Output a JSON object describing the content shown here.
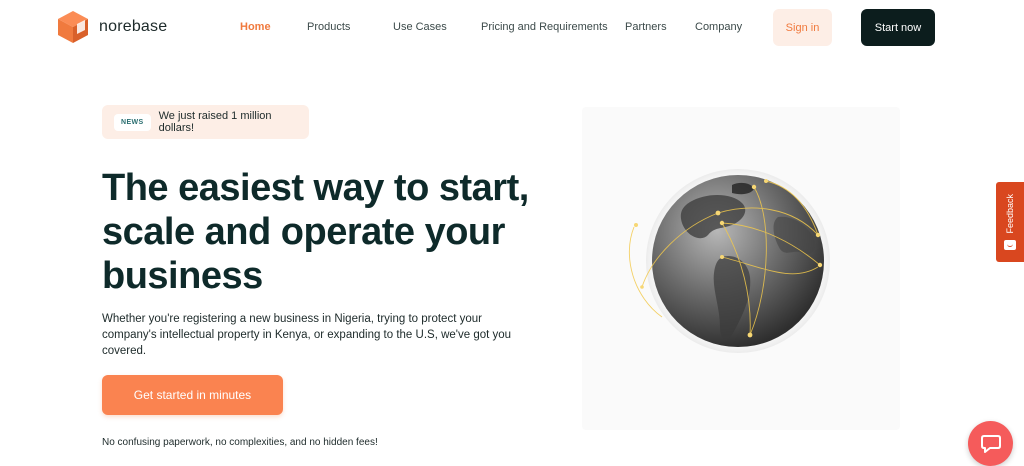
{
  "brand": {
    "name": "norebase",
    "accent": "#f07a3e",
    "dark": "#0c1d1d"
  },
  "nav": {
    "items": [
      {
        "label": "Home",
        "active": true
      },
      {
        "label": "Products",
        "active": false
      },
      {
        "label": "Use Cases",
        "active": false
      },
      {
        "label": "Pricing and Requirements",
        "active": false
      },
      {
        "label": "Partners",
        "active": false
      },
      {
        "label": "Company",
        "active": false
      }
    ],
    "signin_label": "Sign in",
    "start_label": "Start now"
  },
  "news": {
    "badge": "NEWS",
    "text": "We just raised 1 million dollars!"
  },
  "hero": {
    "title": "The easiest way to start, scale and operate your business",
    "subtitle": "Whether you're registering a new business in Nigeria, trying to protect your company's intellectual property in Kenya, or expanding to the U.S, we've got you covered.",
    "cta_label": "Get started in minutes",
    "footnote": "No confusing paperwork, no complexities, and no hidden fees!"
  },
  "feedback": {
    "label": "Feedback",
    "icon": "smile-icon"
  },
  "chat": {
    "icon": "chat-bubble-icon",
    "color": "#f55b5b"
  },
  "globe": {
    "icon": "globe-icon",
    "line_color": "#f2c94c"
  }
}
